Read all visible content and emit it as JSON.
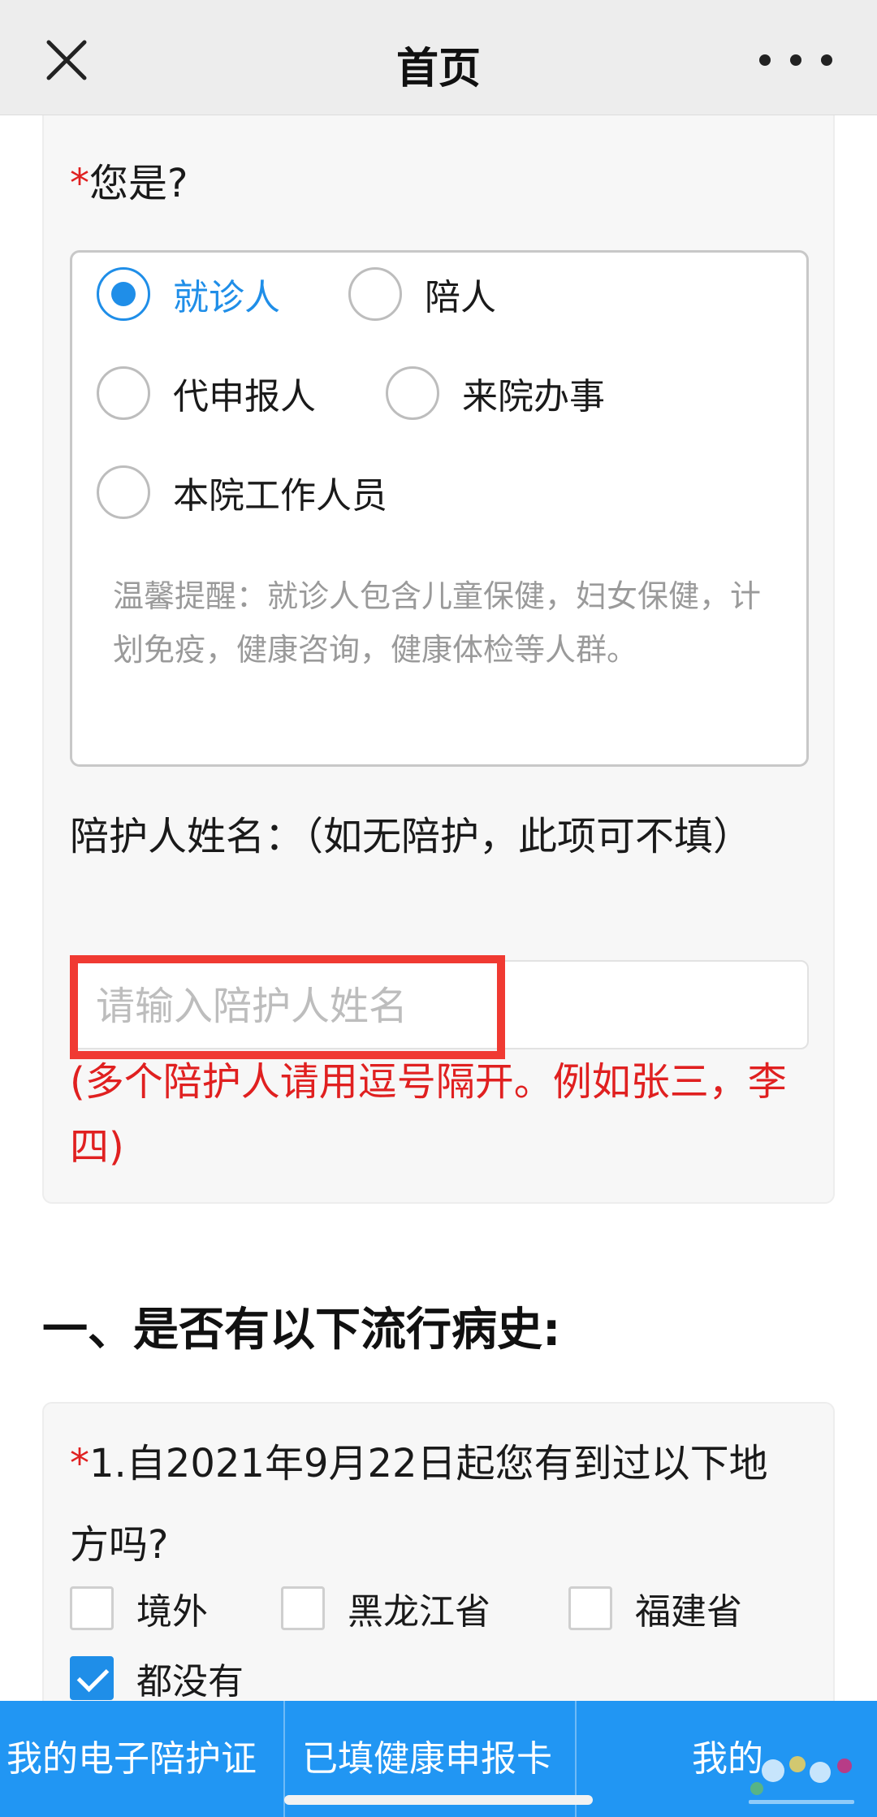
{
  "header": {
    "title": "首页"
  },
  "section1": {
    "question_label": "您是?",
    "required_mark": "*",
    "options": [
      {
        "label": "就诊人",
        "selected": true
      },
      {
        "label": "陪人",
        "selected": false
      },
      {
        "label": "代申报人",
        "selected": false
      },
      {
        "label": "来院办事",
        "selected": false
      },
      {
        "label": "本院工作人员",
        "selected": false
      }
    ],
    "tip": "温馨提醒：就诊人包含儿童保健，妇女保健，计划免疫，健康咨询，健康体检等人群。",
    "companion_label": "陪护人姓名：（如无陪护，此项可不填）",
    "companion_placeholder": "请输入陪护人姓名",
    "companion_hint": "(多个陪护人请用逗号隔开。例如张三，李四)"
  },
  "section2": {
    "title": "一、是否有以下流行病史:",
    "question": "1.自2021年9月22日起您有到过以下地方吗?",
    "required_mark": "*",
    "options": [
      {
        "label": "境外",
        "checked": false
      },
      {
        "label": "黑龙江省",
        "checked": false
      },
      {
        "label": "福建省",
        "checked": false
      },
      {
        "label": "都没有",
        "checked": true
      }
    ]
  },
  "bottom_nav": [
    {
      "label": "我的电子陪护证"
    },
    {
      "label": "已填健康申报卡"
    },
    {
      "label": "我的"
    }
  ],
  "colors": {
    "accent": "#1f8ee8",
    "nav": "#2196f3",
    "required": "#e02020",
    "highlight": "#f03a32"
  },
  "icons": {
    "close": "close-icon",
    "more": "more-icon",
    "watermark": "site-logo"
  }
}
